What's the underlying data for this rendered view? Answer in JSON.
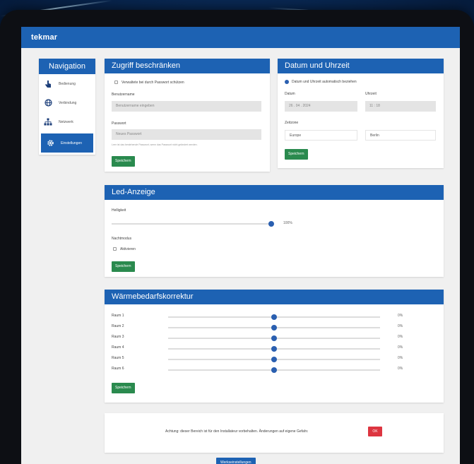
{
  "header": {
    "brand": "tekmar"
  },
  "nav": {
    "title": "Navigation",
    "items": [
      {
        "label": "Bedienung",
        "icon": "touch-icon",
        "active": false
      },
      {
        "label": "Verbindung",
        "icon": "globe-icon",
        "active": false
      },
      {
        "label": "Netzwerk",
        "icon": "network-icon",
        "active": false
      },
      {
        "label": "Einstellungen",
        "icon": "gear-icon",
        "active": true
      }
    ]
  },
  "access": {
    "title": "Zugriff beschränken",
    "checkbox_label": "Verwaltete bei durch Passwort schützen",
    "username_label": "Benutzername",
    "username_placeholder": "Benutzername eingeben",
    "password_label": "Passwort",
    "password_placeholder": "Neues Passwort",
    "hint": "Leer ist das bestehende Passwort, wenn das Passwort nicht geändert werden.",
    "save": "Speichern"
  },
  "datetime": {
    "title": "Datum und Uhrzeit",
    "radio_label": "Datum und Uhrzeit automatisch beziehen",
    "date_label": "Datum",
    "date_value": "26 . 04 . 2024",
    "time_label": "Uhrzeit",
    "time_value": "11 : 18",
    "zone_label": "Zeitzone",
    "zone_region": "Europe",
    "zone_city": "Berlin",
    "save": "Speichern"
  },
  "led": {
    "title": "Led-Anzeige",
    "brightness_label": "Helligkeit",
    "brightness_value": "100%",
    "brightness_level": 1.0,
    "night_label": "Nachtmodus",
    "night_checkbox": "Aktivieren",
    "save": "Speichern"
  },
  "heat": {
    "title": "Wärmebedarfskorrektur",
    "rooms": [
      {
        "label": "Raum 1",
        "value": "0%"
      },
      {
        "label": "Raum 2",
        "value": "0%"
      },
      {
        "label": "Raum 3",
        "value": "0%"
      },
      {
        "label": "Raum 4",
        "value": "0%"
      },
      {
        "label": "Raum 5",
        "value": "0%"
      },
      {
        "label": "Raum 6",
        "value": "0%"
      }
    ],
    "slider_level": 0.5,
    "save": "Speichern"
  },
  "warning": {
    "text": "Achtung: dieser Bereich ist für den Installateur vorbehalten. Änderungen auf eigene Gefahr.",
    "ok": "OK"
  },
  "footer_button": "Werkseinstellungen"
}
